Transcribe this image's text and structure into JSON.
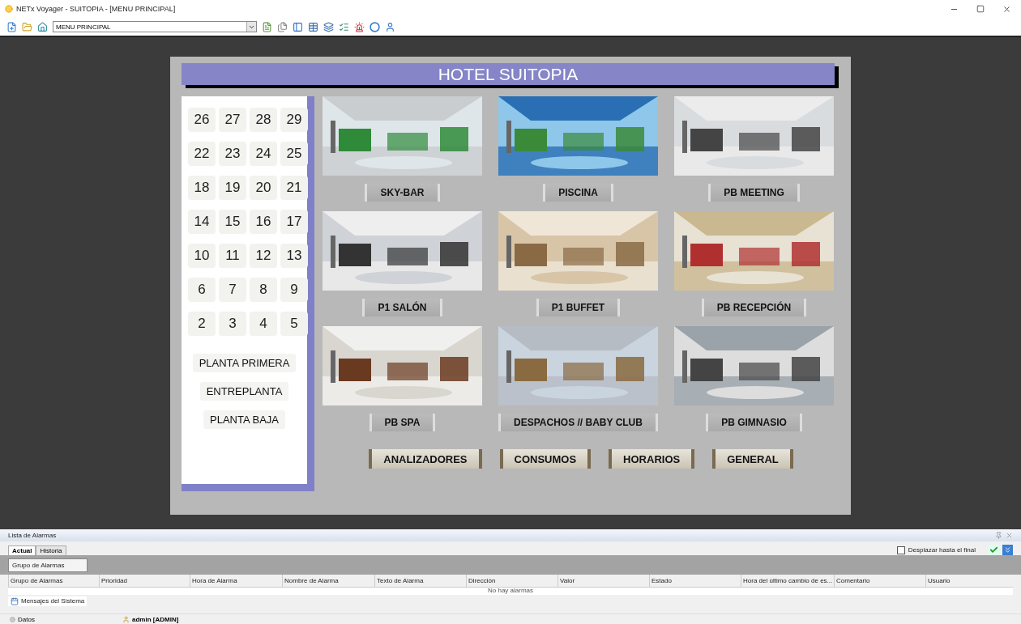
{
  "window": {
    "title": "NETx Voyager - SUITOPIA - [MENU PRINCIPAL]"
  },
  "toolbar": {
    "page_select": "MENU PRINCIPAL"
  },
  "hotel": {
    "title": "HOTEL SUITOPIA",
    "floors": [
      "26",
      "27",
      "28",
      "29",
      "22",
      "23",
      "24",
      "25",
      "18",
      "19",
      "20",
      "21",
      "14",
      "15",
      "16",
      "17",
      "10",
      "11",
      "12",
      "13",
      "6",
      "7",
      "8",
      "9",
      "2",
      "3",
      "4",
      "5"
    ],
    "levels": [
      "PLANTA PRIMERA",
      "ENTREPLANTA",
      "PLANTA BAJA"
    ],
    "areas": [
      {
        "label": "SKY-BAR",
        "kind": "picture"
      },
      {
        "label": "PISCINA",
        "kind": "picture"
      },
      {
        "label": "PB MEETING",
        "kind": "picture"
      },
      {
        "label": "P1 SALÓN",
        "kind": "picture"
      },
      {
        "label": "P1 BUFFET",
        "kind": "picture"
      },
      {
        "label": "PB RECEPCIÓN",
        "kind": "picture"
      },
      {
        "label": "PB SPA",
        "kind": "picture"
      },
      {
        "label": "DESPACHOS // BABY CLUB",
        "kind": "picture"
      },
      {
        "label": "PB GIMNASIO",
        "kind": "picture"
      }
    ],
    "menu_buttons": [
      "ANALIZADORES",
      "CONSUMOS",
      "HORARIOS",
      "GENERAL"
    ]
  },
  "alarm_list": {
    "title": "Lista de Alarmas",
    "tabs": [
      {
        "label": "Actual",
        "selected": true
      },
      {
        "label": "Historia",
        "selected": false
      }
    ],
    "scroll_to_end": {
      "label": "Desplazar hasta el final",
      "checked": false
    },
    "group_by": "Grupo de Alarmas",
    "columns": [
      "Grupo de Alarmas",
      "Prioridad",
      "Hora de Alarma",
      "Nombre de Alarma",
      "Texto de Alarma",
      "Dirección",
      "Valor",
      "Estado",
      "Hora del último cambio de es...",
      "Comentario",
      "Usuario"
    ],
    "empty_message": "No hay alarmas"
  },
  "system_messages_tab": "Mensajes del Sistema",
  "status_bar": {
    "connection": "Datos",
    "user": "admin [ADMIN]"
  }
}
